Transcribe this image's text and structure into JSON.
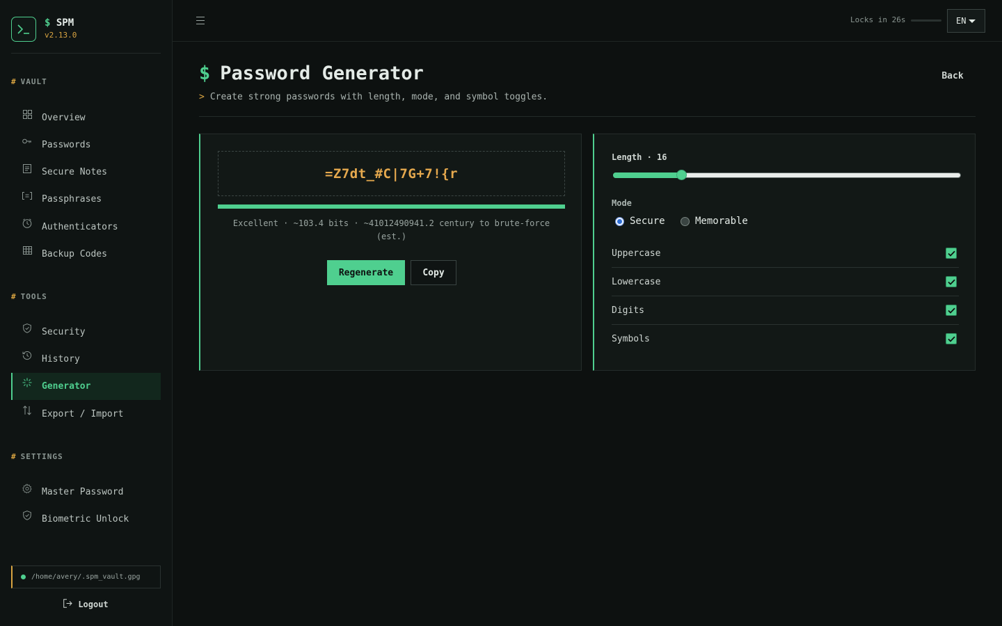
{
  "brand": {
    "name": "SPM",
    "prefix": "$",
    "version": "v2.13.0"
  },
  "sidebar": {
    "sections": [
      {
        "title": "VAULT",
        "items": [
          {
            "label": "Overview",
            "icon": "grid-icon"
          },
          {
            "label": "Passwords",
            "icon": "key-icon"
          },
          {
            "label": "Secure Notes",
            "icon": "note-icon"
          },
          {
            "label": "Passphrases",
            "icon": "passphrase-icon"
          },
          {
            "label": "Authenticators",
            "icon": "clock-icon"
          },
          {
            "label": "Backup Codes",
            "icon": "table-icon"
          }
        ]
      },
      {
        "title": "TOOLS",
        "items": [
          {
            "label": "Security",
            "icon": "shield-icon"
          },
          {
            "label": "History",
            "icon": "history-icon"
          },
          {
            "label": "Generator",
            "icon": "sparkle-icon",
            "active": true
          },
          {
            "label": "Export / Import",
            "icon": "arrows-icon"
          }
        ]
      },
      {
        "title": "SETTINGS",
        "items": [
          {
            "label": "Master Password",
            "icon": "gear-icon"
          },
          {
            "label": "Biometric Unlock",
            "icon": "shield-icon"
          }
        ]
      }
    ],
    "vault_path": "/home/avery/.spm_vault.gpg",
    "logout_label": "Logout"
  },
  "topbar": {
    "lock_text": "Locks in 26s",
    "language": "EN"
  },
  "page": {
    "title_prefix": "$",
    "title": "Password Generator",
    "subtitle_prefix": ">",
    "subtitle": "Create strong passwords with length, mode, and symbol toggles.",
    "back_label": "Back"
  },
  "generator": {
    "password": "=Z7dt_#C|7G+7!{r",
    "strength_fraction": 1.0,
    "strength_text": "Excellent · ~103.4 bits · ~41012490941.2 century to brute-force (est.)",
    "regenerate_label": "Regenerate",
    "copy_label": "Copy"
  },
  "options": {
    "length_label": "Length · 16",
    "length": 16,
    "length_min": 4,
    "length_max": 64,
    "mode_label": "Mode",
    "modes": [
      {
        "label": "Secure",
        "selected": true
      },
      {
        "label": "Memorable",
        "selected": false
      }
    ],
    "toggles": [
      {
        "label": "Uppercase",
        "checked": true
      },
      {
        "label": "Lowercase",
        "checked": true
      },
      {
        "label": "Digits",
        "checked": true
      },
      {
        "label": "Symbols",
        "checked": true
      }
    ]
  },
  "colors": {
    "accent": "#4fcf8f",
    "warning": "#d9a441",
    "background": "#0d1110"
  }
}
